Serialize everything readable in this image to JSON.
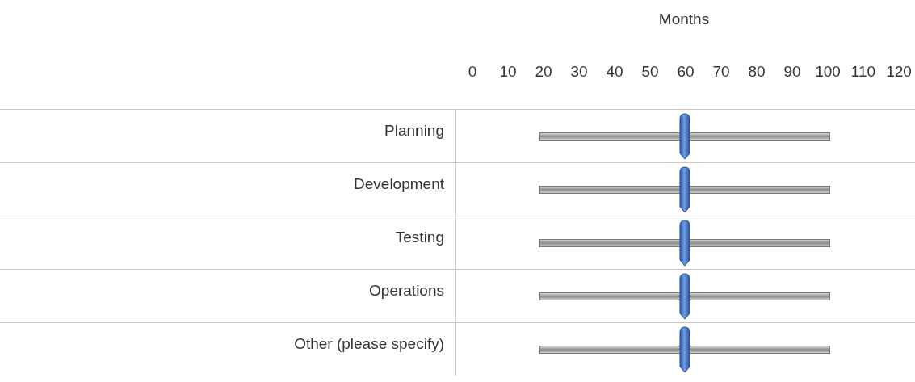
{
  "header": {
    "title": "Months",
    "scale": [
      "0",
      "10",
      "20",
      "30",
      "40",
      "50",
      "60",
      "70",
      "80",
      "90",
      "100",
      "110",
      "120"
    ]
  },
  "rows": [
    {
      "label": "Planning",
      "level": 0.5
    },
    {
      "label": "Development",
      "level": 0.5
    },
    {
      "label": "Testing",
      "level": 0.5
    },
    {
      "label": "Operations",
      "level": 0.5
    },
    {
      "label": "Other (please specify)",
      "level": 0.5
    }
  ]
}
